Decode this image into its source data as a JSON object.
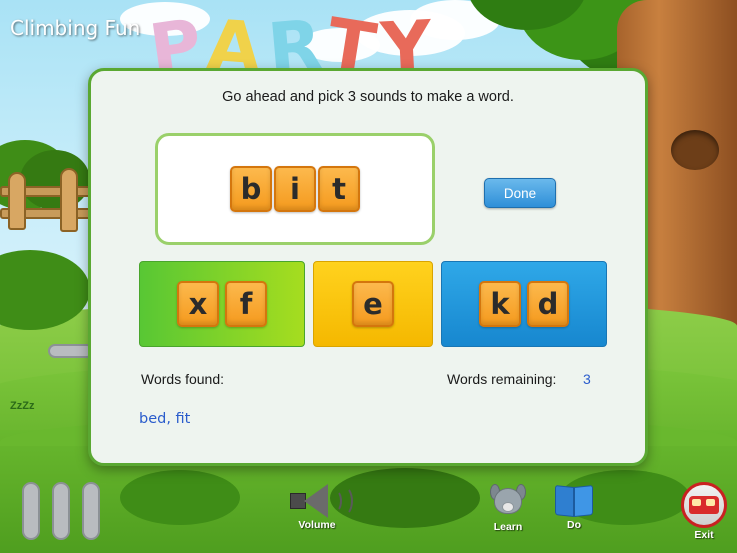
{
  "game": {
    "title": "Climbing Fun",
    "prompt": "Go ahead and pick 3 sounds to make a word."
  },
  "word_panel": {
    "tiles": [
      "b",
      "i",
      "t"
    ]
  },
  "done_button": {
    "label": "Done"
  },
  "sound_groups": [
    {
      "color": "#58c734",
      "name": "green-group",
      "letters": [
        "x",
        "f"
      ]
    },
    {
      "color": "#ffd21e",
      "name": "yellow-group",
      "letters": [
        "e"
      ]
    },
    {
      "color": "#2fa8e8",
      "name": "blue-group",
      "letters": [
        "k",
        "d"
      ]
    }
  ],
  "status": {
    "found_label": "Words found:",
    "found_words": "bed, fit",
    "remaining_label": "Words remaining:",
    "remaining_value": "3"
  },
  "toolbar": {
    "volume": {
      "label": "Volume",
      "icon": "speaker-icon"
    },
    "learn": {
      "label": "Learn",
      "icon": "dog-icon"
    },
    "do": {
      "label": "Do",
      "icon": "book-icon"
    },
    "exit": {
      "label": "Exit",
      "icon": "bus-icon"
    }
  },
  "decor": {
    "balloon_letters": [
      {
        "char": "P",
        "color": "#e8b6d8"
      },
      {
        "char": "A",
        "color": "#f0d24a"
      },
      {
        "char": "R",
        "color": "#7fd4e8"
      },
      {
        "char": "T",
        "color": "#e86a5a"
      },
      {
        "char": "Y",
        "color": "#e86a5a"
      }
    ],
    "zzz": "ZzZz"
  },
  "colors": {
    "accent_green": "#5aa832",
    "tile_orange": "#fcb94d",
    "link_blue": "#2a5ccc",
    "button_blue": "#2f8fd8"
  }
}
